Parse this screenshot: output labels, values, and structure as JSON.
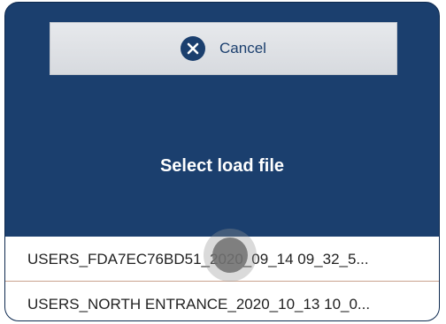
{
  "dialog": {
    "cancel_label": "Cancel",
    "cancel_icon": "close-circle-icon",
    "title": "Select load file"
  },
  "files": [
    {
      "name": "USERS_FDA7EC76BD51_2020_09_14 09_32_5..."
    },
    {
      "name": "USERS_NORTH ENTRANCE_2020_10_13 10_0..."
    }
  ],
  "colors": {
    "primary": "#1b3f6e",
    "button_bg": "#e0e3e7",
    "divider": "#c9a28e"
  }
}
